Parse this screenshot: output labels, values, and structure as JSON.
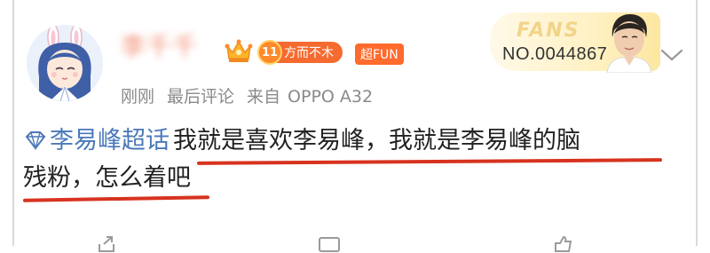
{
  "user": {
    "name": "李千千",
    "level_badge_number": "11",
    "level_badge_label": "方而不木",
    "superfun_label": "超FUN"
  },
  "meta": {
    "time": "刚刚",
    "last_comment": "最后评论",
    "source_prefix": "来自",
    "device": "OPPO A32"
  },
  "fans_card": {
    "label": "FANS",
    "number": "NO.0044867"
  },
  "post": {
    "topic": "李易峰超话",
    "line1": "我就是喜欢李易峰，我就是李易峰的脑",
    "line2": "残粉，怎么着吧"
  },
  "colors": {
    "topic_link": "#4b79b9",
    "underline": "#d7331f",
    "badge_orange": "#f56b2f",
    "meta_gray": "#8a8a8a"
  },
  "icons": {
    "topic": "diamond-icon",
    "more": "chevron-down-icon",
    "repost": "share-icon",
    "comment": "comment-icon",
    "like": "like-icon"
  }
}
